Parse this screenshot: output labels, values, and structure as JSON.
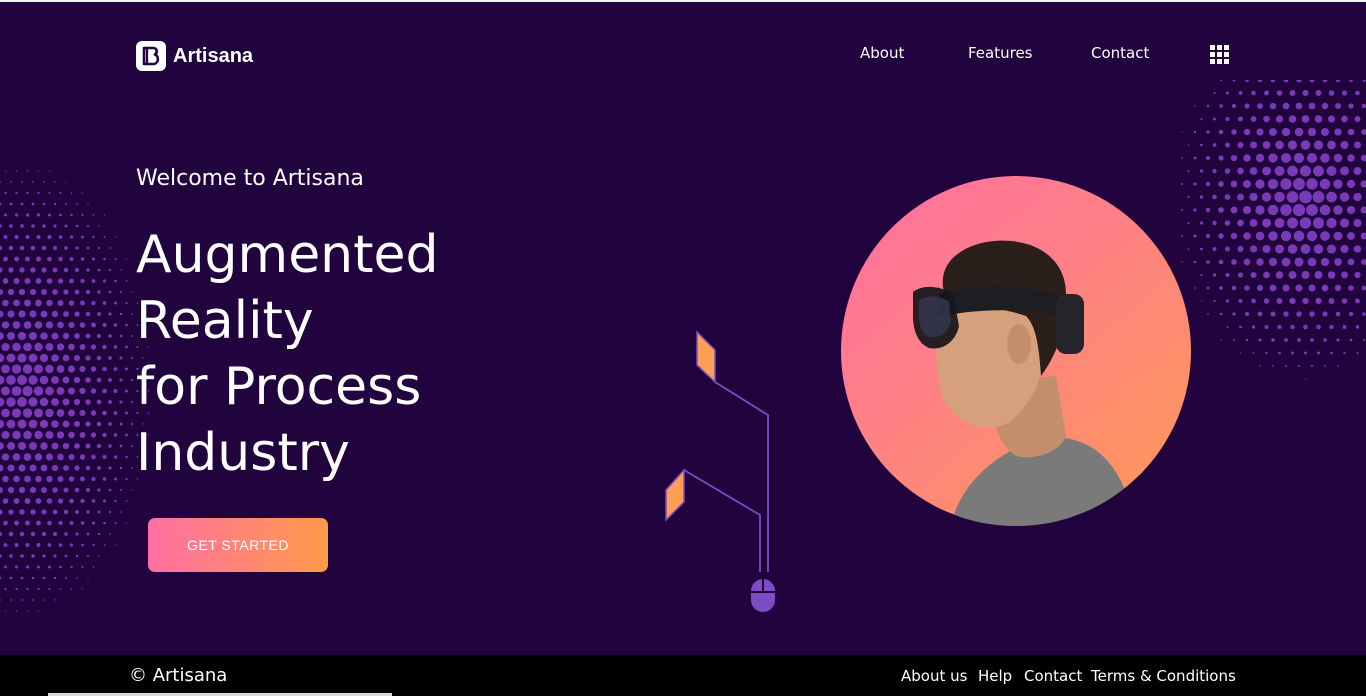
{
  "brand": {
    "name": "Artisana"
  },
  "nav": {
    "items": [
      {
        "label": "About"
      },
      {
        "label": "Features"
      },
      {
        "label": "Contact"
      }
    ],
    "menu_icon": "grid-menu-icon"
  },
  "hero": {
    "welcome": "Welcome to Artisana",
    "headline_lines": [
      "Augmented",
      "Reality",
      "for Process",
      "Industry"
    ],
    "cta_label": "GET STARTED"
  },
  "footer": {
    "copyright": "© Artisana",
    "links": [
      {
        "label": "About us"
      },
      {
        "label": "Help"
      },
      {
        "label": "Contact"
      },
      {
        "label": "Terms & Conditions"
      }
    ]
  },
  "colors": {
    "background": "#21033d",
    "accent_pink": "#ff6fa4",
    "accent_orange": "#ff9a4a",
    "dots_purple": "#7a3ab8",
    "footer": "#000000"
  }
}
